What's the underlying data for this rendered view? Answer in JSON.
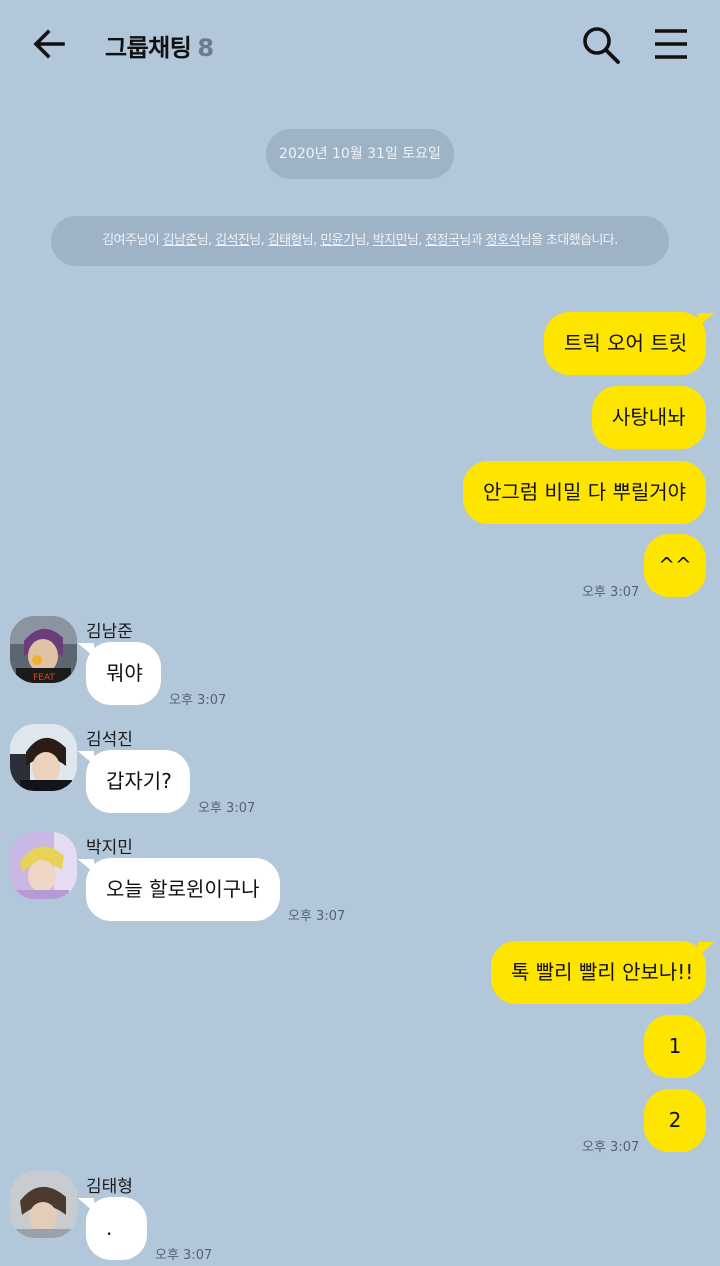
{
  "header": {
    "title": "그룹채팅",
    "member_count": "8"
  },
  "date_divider": "2020년 10월 31일 토요일",
  "system_message": {
    "parts": [
      {
        "text": "김여주님이 ",
        "underline": false
      },
      {
        "text": "김남준",
        "underline": true
      },
      {
        "text": "님, ",
        "underline": false
      },
      {
        "text": "김석진",
        "underline": true
      },
      {
        "text": "님, ",
        "underline": false
      },
      {
        "text": "김태형",
        "underline": true
      },
      {
        "text": "님, ",
        "underline": false
      },
      {
        "text": "민윤기",
        "underline": true
      },
      {
        "text": "님, ",
        "underline": false
      },
      {
        "text": "박지민",
        "underline": true
      },
      {
        "text": "님, ",
        "underline": false
      },
      {
        "text": "전정국",
        "underline": true
      },
      {
        "text": "님과 ",
        "underline": false
      },
      {
        "text": "정호석",
        "underline": true
      },
      {
        "text": "님을 초대했습니다.",
        "underline": false
      }
    ]
  },
  "messages": {
    "m1": "트릭 오어 트릿",
    "m2": "사탕내놔",
    "m3": "안그럼 비밀 다 뿌릴거야",
    "m4": "^^",
    "t1": "오후 3:07",
    "namjoon_name": "김남준",
    "namjoon_msg": "뭐야",
    "namjoon_time": "오후 3:07",
    "seokjin_name": "김석진",
    "seokjin_msg": "갑자기?",
    "seokjin_time": "오후 3:07",
    "jimin_name": "박지민",
    "jimin_msg": "오늘 할로윈이구나",
    "jimin_time": "오후 3:07",
    "m5": "톡 빨리 빨리 안보나!!",
    "m6": "1",
    "m7": "2",
    "t2": "오후 3:07",
    "taehyung_name": "김태형",
    "taehyung_msg": ".",
    "taehyung_time": "오후 3:07"
  },
  "colors": {
    "background": "#b2c7da",
    "my_bubble": "#fee500",
    "other_bubble": "#ffffff",
    "pill": "#9fb3c6"
  },
  "icons": [
    "back-arrow-icon",
    "search-icon",
    "menu-icon"
  ]
}
